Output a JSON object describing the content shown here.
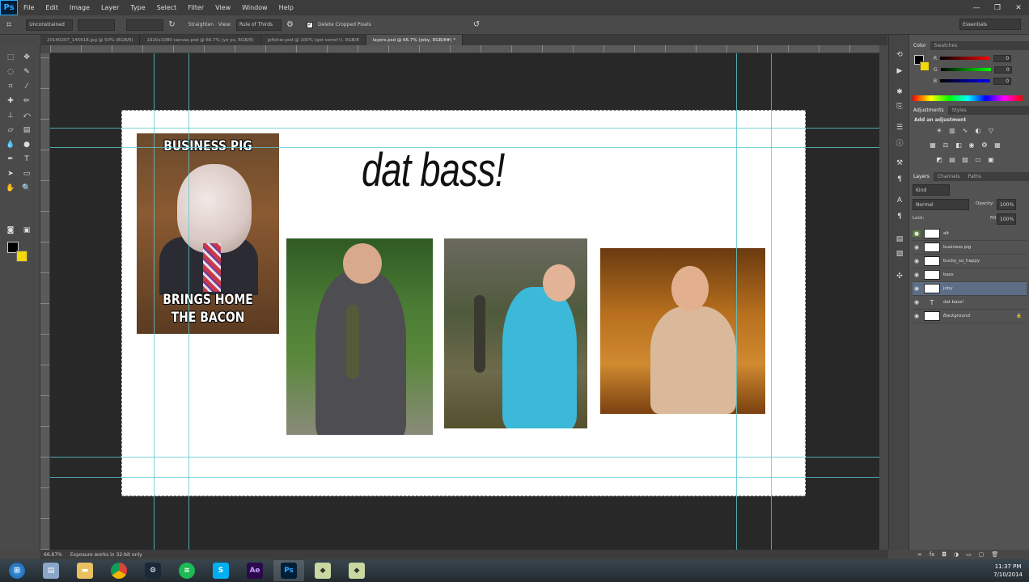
{
  "app": {
    "logo": "Ps"
  },
  "menu": [
    "File",
    "Edit",
    "Image",
    "Layer",
    "Type",
    "Select",
    "Filter",
    "View",
    "Window",
    "Help"
  ],
  "window_controls": [
    "—",
    "❐",
    "✕"
  ],
  "options_bar": {
    "ratio": "Unconstrained",
    "straighten": "Straighten",
    "view_label": "View:",
    "view_value": "Rule of Thirds",
    "delete_cropped": "Delete Cropped Pixels",
    "workspace": "Essentials"
  },
  "doc_tabs": [
    "20140207_145618.jpg @ 50% (RGB/8)",
    "1920x1080 canvas.psd @ 66.7% (yo yo, RGB/8)",
    "jpfisher.psd @ 100% (get some!!), RGB/8",
    "layers.psd @ 66.7% (joby, RGB/8#) *"
  ],
  "canvas": {
    "title": "dat bass!",
    "meme_top": "BUSINESS PIG",
    "meme_bottom_1": "BRINGS HOME",
    "meme_bottom_2": "THE BACON"
  },
  "panels": {
    "color_tabs": [
      "Color",
      "Swatches"
    ],
    "color_labels": [
      "R",
      "G",
      "B"
    ],
    "color_values": [
      "0",
      "0",
      "0"
    ],
    "adjust_tabs": [
      "Adjustments",
      "Styles"
    ],
    "adjust_title": "Add an adjustment",
    "layers_tabs": [
      "Layers",
      "Channels",
      "Paths"
    ],
    "kind": "Kind",
    "blend_mode": "Normal",
    "opacity_label": "Opacity:",
    "opacity_value": "100%",
    "lock_label": "Lock:",
    "fill_label": "Fill:",
    "fill_value": "100%",
    "layers": [
      "alt",
      "business pig",
      "bucky_so_happy",
      "bass",
      "joby",
      "dat bass!",
      "Background"
    ]
  },
  "status": {
    "zoom": "66.67%",
    "info": "Exposure works in 32-bit only"
  },
  "taskbar": {
    "time": "11:37 PM",
    "date": "7/10/2014"
  },
  "colors": {
    "fg": "#000000",
    "bg": "#f5d80a",
    "guide": "#5cc8d0",
    "selected_layer": "#5d6e87"
  }
}
